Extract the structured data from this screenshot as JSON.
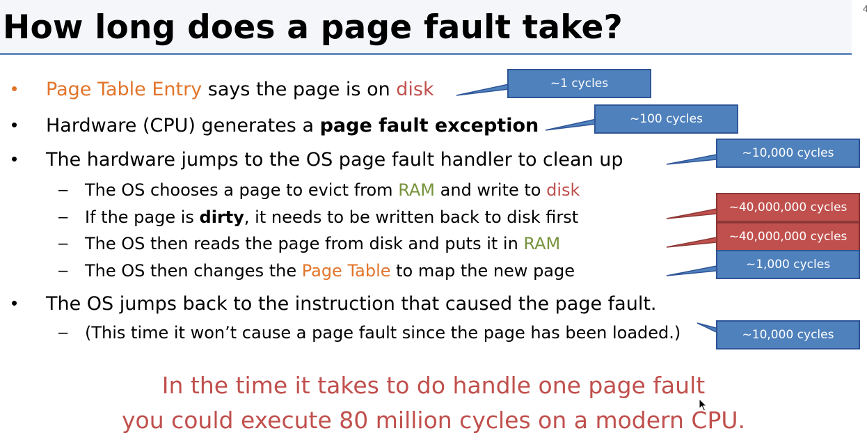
{
  "title": "How long does a page fault take?",
  "page_number": "4",
  "bullets": {
    "b1": {
      "pte": "Page Table Entry",
      "mid": " says the page is on ",
      "disk": "disk"
    },
    "b2": {
      "pre": "Hardware (CPU) generates a ",
      "bold": "page fault exception"
    },
    "b3": {
      "text": "The hardware jumps to the OS page fault handler to clean up"
    },
    "s1": {
      "pre": "The OS chooses a page to evict from ",
      "ram": "RAM",
      "mid": " and write to ",
      "disk": "disk"
    },
    "s2": {
      "pre": "If the page is ",
      "bold": "dirty",
      "post": ", it needs to be written back to disk first"
    },
    "s3": {
      "pre": "The OS then reads the page from disk and puts it in ",
      "ram": "RAM"
    },
    "s4": {
      "pre": "The OS then changes the ",
      "pt": "Page Table",
      "post": " to map the new page"
    },
    "b4": {
      "text": "The OS jumps back to the instruction that caused the page fault."
    },
    "s5": {
      "text": "(This time it won’t cause a page fault since the page has been loaded.)"
    }
  },
  "markers": {
    "bullet": "•",
    "dash": "–"
  },
  "callouts": [
    {
      "label": "~1 cycles",
      "color": "#4f81bd"
    },
    {
      "label": "~100 cycles",
      "color": "#4f81bd"
    },
    {
      "label": "~10,000 cycles",
      "color": "#4f81bd"
    },
    {
      "label": "~40,000,000 cycles",
      "color": "#c0504d"
    },
    {
      "label": "~40,000,000 cycles",
      "color": "#c0504d"
    },
    {
      "label": "~1,000 cycles",
      "color": "#4f81bd"
    },
    {
      "label": "~10,000 cycles",
      "color": "#4f81bd"
    }
  ],
  "conclusion": {
    "line1": "In the time it takes to do handle one page fault",
    "line2": "you could execute 80 million cycles on a modern CPU."
  },
  "colors": {
    "accent_orange": "#e2742a",
    "accent_red": "#c0504d",
    "accent_green": "#77933c",
    "callout_blue": "#4f81bd"
  }
}
